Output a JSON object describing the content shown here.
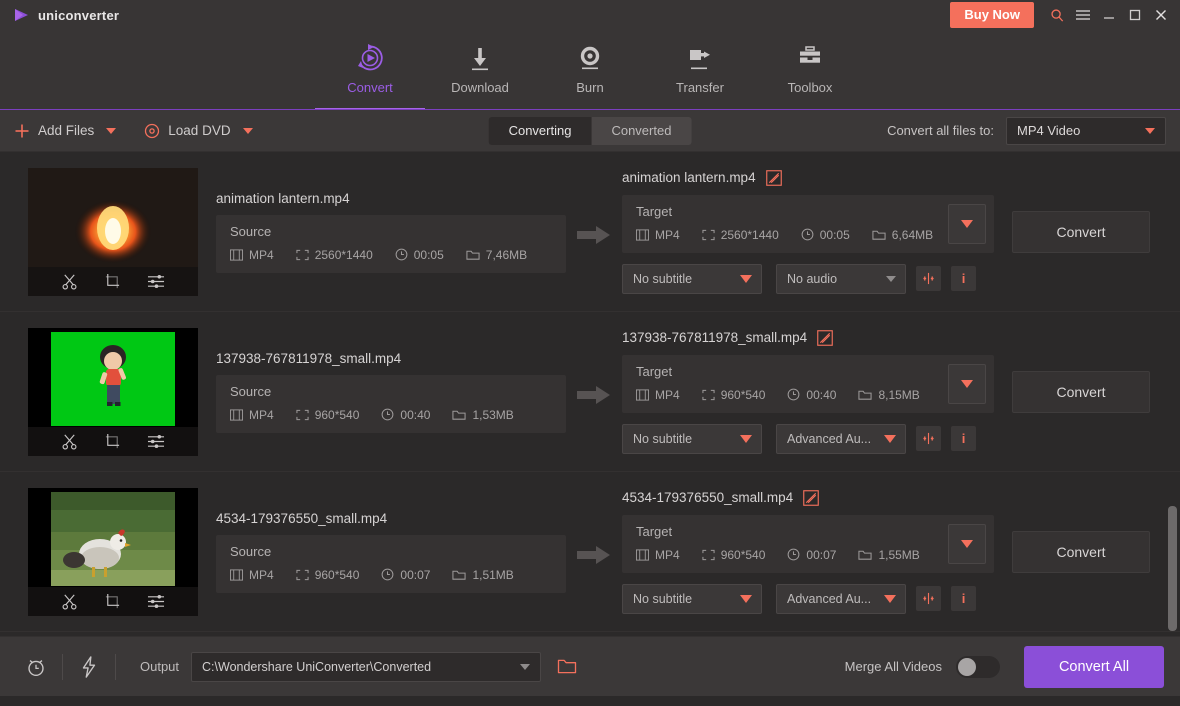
{
  "app": {
    "name": "uniconverter",
    "logo_icon": "play-triangle-icon"
  },
  "titlebar": {
    "buy_now": "Buy Now",
    "icons": [
      "search-icon",
      "menu-icon",
      "minimize-icon",
      "maximize-icon",
      "close-icon"
    ]
  },
  "nav": {
    "items": [
      {
        "label": "Convert",
        "icon": "convert-circular-arrow-icon",
        "active": true
      },
      {
        "label": "Download",
        "icon": "download-arrow-icon",
        "active": false
      },
      {
        "label": "Burn",
        "icon": "burn-disc-icon",
        "active": false
      },
      {
        "label": "Transfer",
        "icon": "transfer-arrow-icon",
        "active": false
      },
      {
        "label": "Toolbox",
        "icon": "toolbox-icon",
        "active": false
      }
    ]
  },
  "toolbar": {
    "add_files": "Add Files",
    "add_files_icon": "plus-icon",
    "load_dvd": "Load DVD",
    "load_dvd_icon": "disc-icon",
    "tabs": [
      {
        "label": "Converting",
        "active": true
      },
      {
        "label": "Converted",
        "active": false
      }
    ],
    "convert_all_label": "Convert all files to:",
    "format_value": "MP4 Video"
  },
  "colors": {
    "accent_purple": "#8b4fd8",
    "accent_coral": "#f4705c",
    "nav_active": "#9b5de5",
    "panel_bg": "#383535",
    "page_bg": "#2b2929"
  },
  "rows": [
    {
      "thumb": "fire-lantern-thumbnail",
      "thumb_tools": [
        "trim-scissors-icon",
        "crop-icon",
        "effects-sliders-icon"
      ],
      "source_name": "animation lantern.mp4",
      "source": {
        "title": "Source",
        "format": "MP4",
        "resolution": "2560*1440",
        "duration": "00:05",
        "size": "7,46MB"
      },
      "target_name": "animation lantern.mp4",
      "target": {
        "title": "Target",
        "format": "MP4",
        "resolution": "2560*1440",
        "duration": "00:05",
        "size": "6,64MB"
      },
      "subtitle": "No subtitle",
      "subtitle_caret": "coral",
      "audio": "No audio",
      "audio_caret": "gray",
      "add_button": "+|+",
      "info_button": "i",
      "convert_label": "Convert"
    },
    {
      "thumb": "green-screen-character-thumbnail",
      "thumb_tools": [
        "trim-scissors-icon",
        "crop-icon",
        "effects-sliders-icon"
      ],
      "source_name": "137938-767811978_small.mp4",
      "source": {
        "title": "Source",
        "format": "MP4",
        "resolution": "960*540",
        "duration": "00:40",
        "size": "1,53MB"
      },
      "target_name": "137938-767811978_small.mp4",
      "target": {
        "title": "Target",
        "format": "MP4",
        "resolution": "960*540",
        "duration": "00:40",
        "size": "8,15MB"
      },
      "subtitle": "No subtitle",
      "subtitle_caret": "coral",
      "audio": "Advanced Au...",
      "audio_caret": "coral",
      "add_button": "+|+",
      "info_button": "i",
      "convert_label": "Convert"
    },
    {
      "thumb": "chicken-outdoor-thumbnail",
      "thumb_tools": [
        "trim-scissors-icon",
        "crop-icon",
        "effects-sliders-icon"
      ],
      "source_name": "4534-179376550_small.mp4",
      "source": {
        "title": "Source",
        "format": "MP4",
        "resolution": "960*540",
        "duration": "00:07",
        "size": "1,51MB"
      },
      "target_name": "4534-179376550_small.mp4",
      "target": {
        "title": "Target",
        "format": "MP4",
        "resolution": "960*540",
        "duration": "00:07",
        "size": "1,55MB"
      },
      "subtitle": "No subtitle",
      "subtitle_caret": "coral",
      "audio": "Advanced Au...",
      "audio_caret": "coral",
      "add_button": "+|+",
      "info_button": "i",
      "convert_label": "Convert"
    }
  ],
  "bottom": {
    "alarm_icon": "alarm-clock-icon",
    "bolt_icon": "lightning-bolt-icon",
    "output_label": "Output",
    "output_path": "C:\\Wondershare UniConverter\\Converted",
    "folder_icon": "open-folder-icon",
    "merge_label": "Merge All Videos",
    "merge_on": false,
    "convert_all": "Convert All"
  }
}
